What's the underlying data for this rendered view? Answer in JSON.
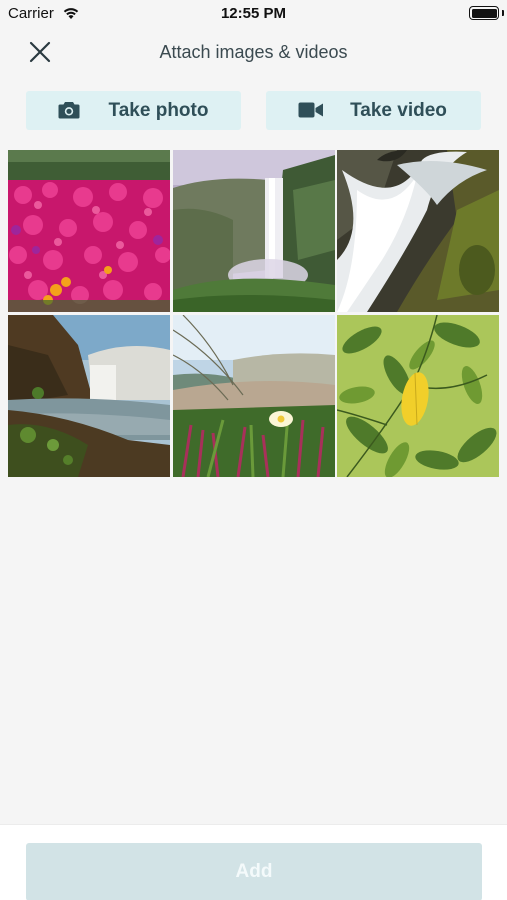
{
  "status_bar": {
    "carrier": "Carrier",
    "time": "12:55 PM"
  },
  "header": {
    "title": "Attach images & videos",
    "close_icon": "close-icon"
  },
  "actions": {
    "take_photo": {
      "label": "Take photo",
      "icon": "camera-icon"
    },
    "take_video": {
      "label": "Take video",
      "icon": "video-camera-icon"
    }
  },
  "gallery": {
    "items": [
      {
        "subject": "pink flowers"
      },
      {
        "subject": "waterfall cliff"
      },
      {
        "subject": "long exposure waterfall"
      },
      {
        "subject": "coastal waterfall"
      },
      {
        "subject": "beach plants"
      },
      {
        "subject": "green leaves"
      }
    ]
  },
  "footer": {
    "add_label": "Add"
  },
  "colors": {
    "accent_bg": "#def1f3",
    "accent_text": "#2f4f58",
    "add_disabled": "#d2e3e6"
  }
}
